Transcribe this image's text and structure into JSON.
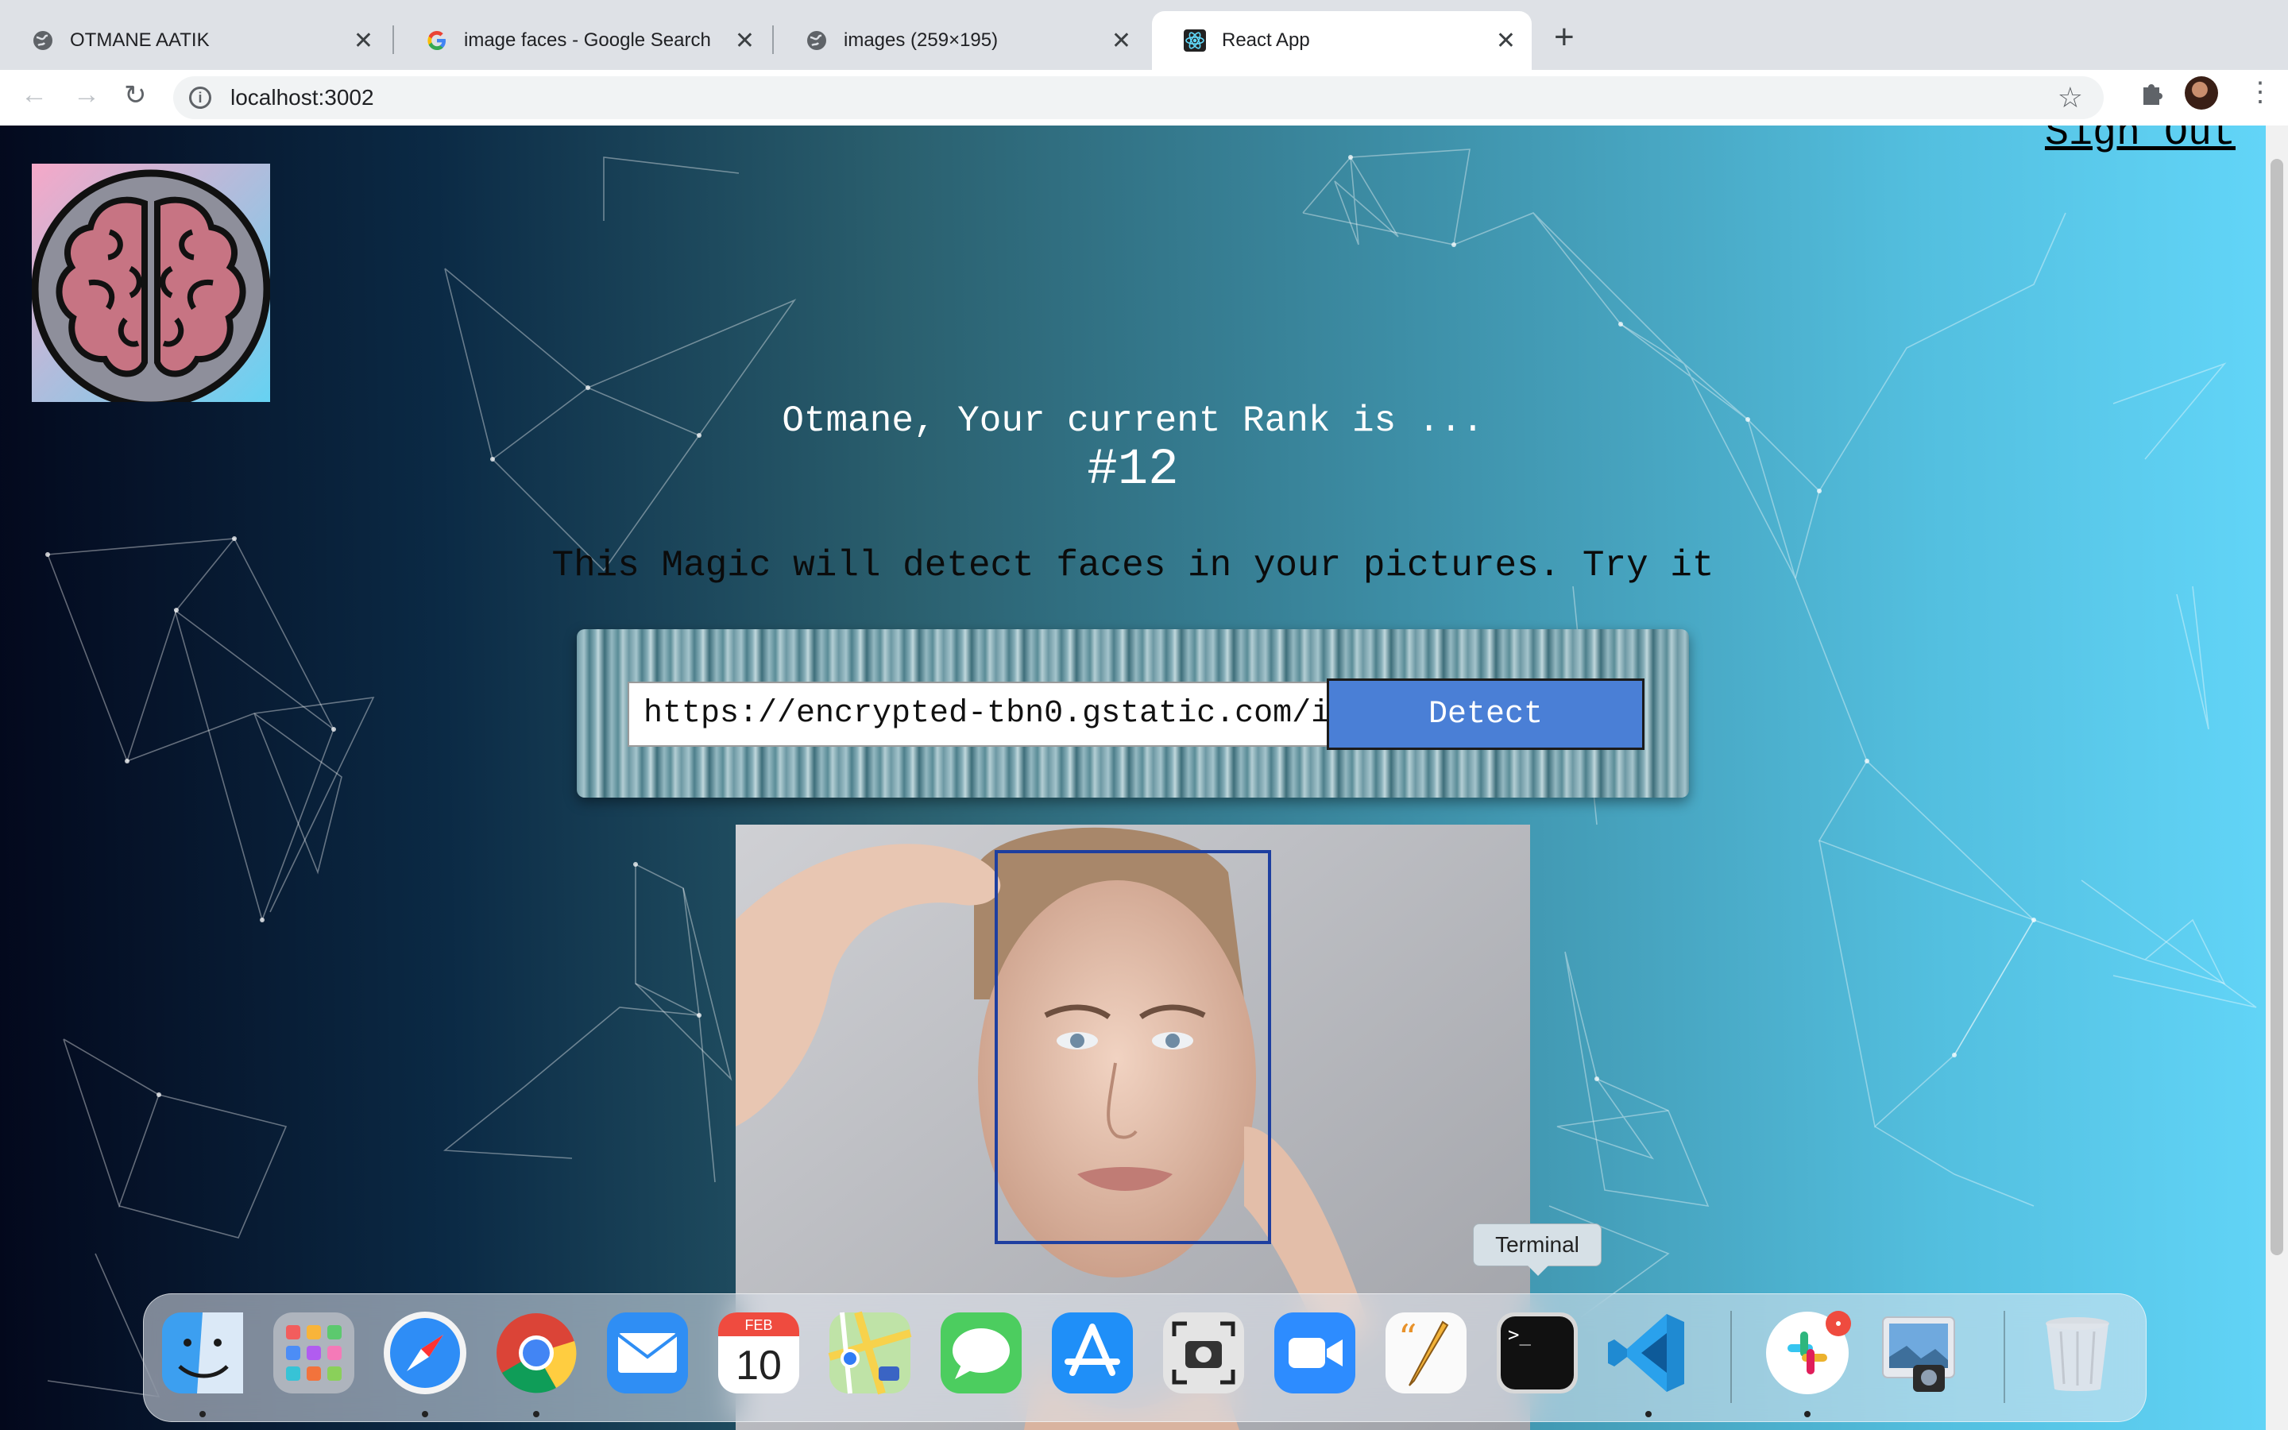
{
  "browser": {
    "tabs": [
      {
        "title": "OTMANE AATIK",
        "active": false
      },
      {
        "title": "image faces - Google Search",
        "active": false
      },
      {
        "title": "images (259×195)",
        "active": false
      },
      {
        "title": "React App",
        "active": true
      }
    ],
    "new_tab_symbol": "+",
    "close_symbol": "✕",
    "address": "localhost:3002"
  },
  "app": {
    "sign_out_label": "Sign Out",
    "rank_text": "Otmane, Your current Rank is ...",
    "rank_value": "#12",
    "tagline": "This Magic will detect faces in your pictures. Try it",
    "image_url_input": "https://encrypted-tbn0.gstatic.com/i",
    "detect_label": "Detect"
  },
  "dock": {
    "tooltip": "Terminal",
    "calendar_month": "FEB",
    "calendar_day": "10",
    "items": [
      "Finder",
      "Launchpad",
      "Safari",
      "Google Chrome",
      "Mail",
      "Calendar",
      "Maps",
      "Messages",
      "App Store",
      "Screenshot",
      "Zoom",
      "Pages",
      "Terminal",
      "Visual Studio Code",
      "Slack",
      "Preview",
      "Trash"
    ]
  },
  "colors": {
    "accent_button": "#4a7fd6",
    "face_box": "#1e3fa0",
    "gradient_left": "#03081c",
    "gradient_right": "#62d5f8"
  }
}
